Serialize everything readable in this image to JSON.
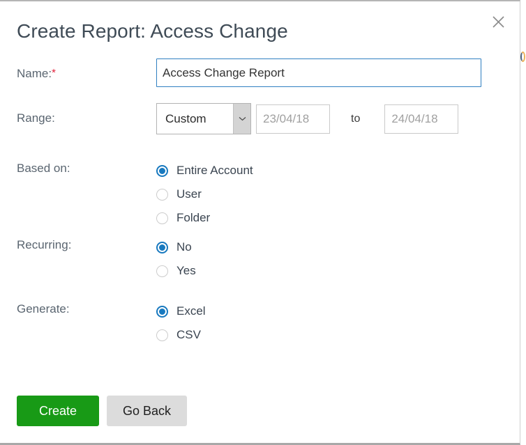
{
  "dialog": {
    "title": "Create Report: Access Change",
    "close_icon": "close-icon"
  },
  "fields": {
    "name": {
      "label": "Name:",
      "required_marker": "*",
      "value": "Access Change Report",
      "placeholder": ""
    },
    "range": {
      "label": "Range:",
      "selected_option": "Custom",
      "options": [
        "Custom"
      ],
      "start_date_value": "",
      "start_date_placeholder": "23/04/18",
      "separator_text": "to",
      "end_date_value": "",
      "end_date_placeholder": "24/04/18"
    },
    "based_on": {
      "label": "Based on:",
      "options": [
        {
          "label": "Entire Account",
          "checked": true
        },
        {
          "label": "User",
          "checked": false
        },
        {
          "label": "Folder",
          "checked": false
        }
      ]
    },
    "recurring": {
      "label": "Recurring:",
      "options": [
        {
          "label": "No",
          "checked": true
        },
        {
          "label": "Yes",
          "checked": false
        }
      ]
    },
    "generate": {
      "label": "Generate:",
      "options": [
        {
          "label": "Excel",
          "checked": true
        },
        {
          "label": "CSV",
          "checked": false
        }
      ]
    }
  },
  "actions": {
    "create_label": "Create",
    "go_back_label": "Go Back"
  },
  "colors": {
    "create_button": "#189a16",
    "go_back_button": "#dcdcdc",
    "radio_selected": "#1879bf",
    "input_focus_border": "#2f7fc1",
    "required_star": "#e2223b",
    "title_text": "#3f4b56"
  }
}
